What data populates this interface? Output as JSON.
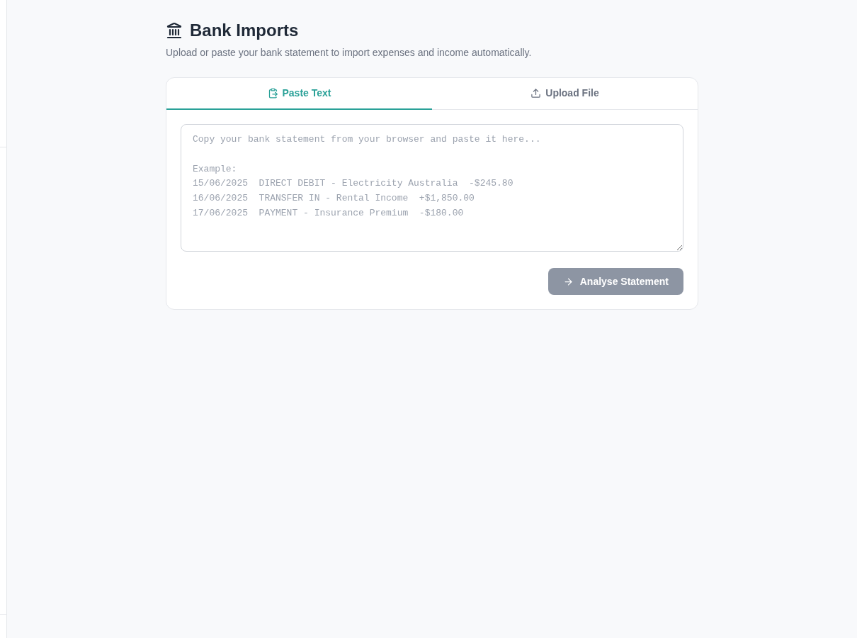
{
  "page": {
    "title": "Bank Imports",
    "subtitle": "Upload or paste your bank statement to import expenses and income automatically."
  },
  "tabs": [
    {
      "label": "Paste Text",
      "kind": "paste",
      "selected": true
    },
    {
      "label": "Upload File",
      "kind": "upload",
      "selected": false
    }
  ],
  "statement_field": {
    "placeholder": "Copy your bank statement from your browser and paste it here...\n\nExample:\n15/06/2025  DIRECT DEBIT - Electricity Australia  -$245.80\n16/06/2025  TRANSFER IN - Rental Income  +$1,850.00\n17/06/2025  PAYMENT - Insurance Premium  -$180.00"
  },
  "analyse_button": {
    "label": "Analyse Statement",
    "disabled": true
  }
}
